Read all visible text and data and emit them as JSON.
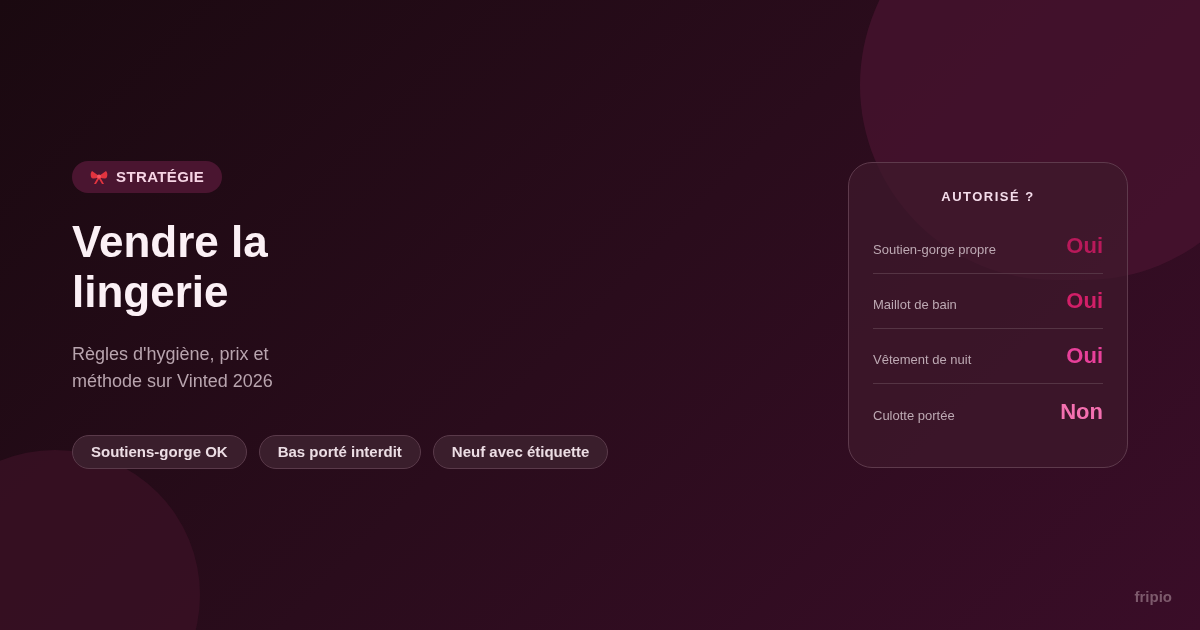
{
  "badge": {
    "label": "STRATÉGIE"
  },
  "title": "Vendre la lingerie",
  "subtitle": "Règles d'hygiène, prix et méthode sur Vinted 2026",
  "chips": [
    "Soutiens-gorge OK",
    "Bas porté interdit",
    "Neuf avec étiquette"
  ],
  "card": {
    "title": "AUTORISÉ ?",
    "rows": [
      {
        "label": "Soutien-gorge propre",
        "answer": "Oui",
        "color": "#b8195a"
      },
      {
        "label": "Maillot de bain",
        "answer": "Oui",
        "color": "#d21f68"
      },
      {
        "label": "Vêtement de nuit",
        "answer": "Oui",
        "color": "#e8409a"
      },
      {
        "label": "Culotte portée",
        "answer": "Non",
        "color": "#f470b0"
      }
    ]
  },
  "brand": "fripio"
}
